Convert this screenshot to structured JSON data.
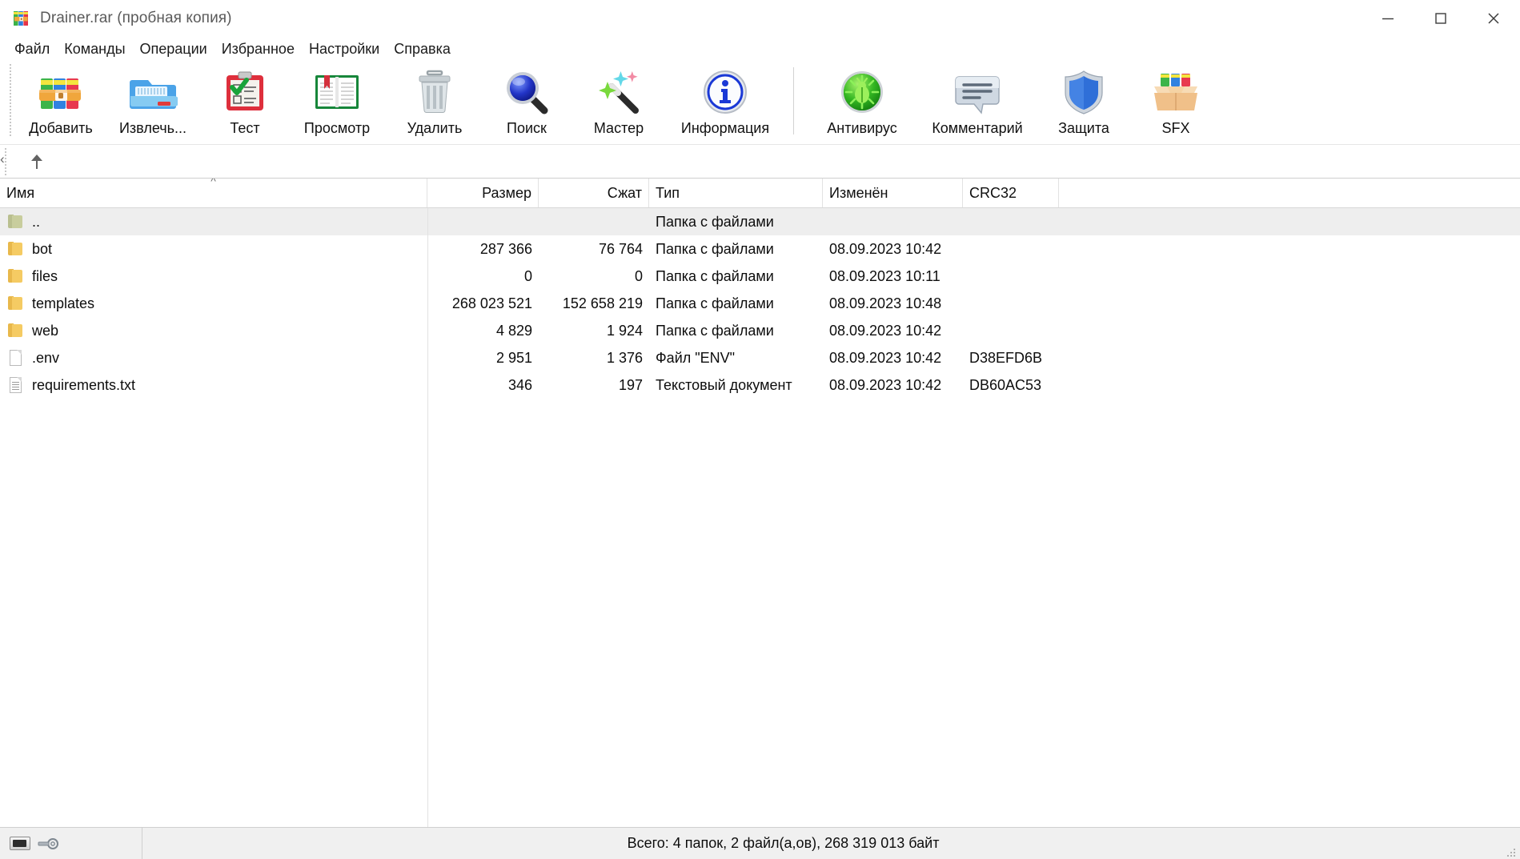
{
  "window": {
    "title": "Drainer.rar (пробная копия)",
    "app_icon": "winrar-books-icon",
    "minimize_label": "—",
    "maximize_label": "□",
    "close_label": "✕"
  },
  "menu": {
    "items": [
      {
        "label": "Файл",
        "name": "menu-file"
      },
      {
        "label": "Команды",
        "name": "menu-commands"
      },
      {
        "label": "Операции",
        "name": "menu-operations"
      },
      {
        "label": "Избранное",
        "name": "menu-favorites"
      },
      {
        "label": "Настройки",
        "name": "menu-settings"
      },
      {
        "label": "Справка",
        "name": "menu-help"
      }
    ]
  },
  "toolbar": {
    "buttons": [
      {
        "label": "Добавить",
        "icon": "add-archive-icon",
        "name": "toolbar-add"
      },
      {
        "label": "Извлечь...",
        "icon": "extract-folder-icon",
        "name": "toolbar-extract"
      },
      {
        "label": "Тест",
        "icon": "test-clipboard-icon",
        "name": "toolbar-test"
      },
      {
        "label": "Просмотр",
        "icon": "view-book-icon",
        "name": "toolbar-view"
      },
      {
        "label": "Удалить",
        "icon": "trash-icon",
        "name": "toolbar-delete"
      },
      {
        "label": "Поиск",
        "icon": "magnifier-icon",
        "name": "toolbar-find"
      },
      {
        "label": "Мастер",
        "icon": "magic-wand-icon",
        "name": "toolbar-wizard"
      },
      {
        "label": "Информация",
        "icon": "info-circle-icon",
        "name": "toolbar-info"
      },
      {
        "label": "Антивирус",
        "icon": "antivirus-bug-icon",
        "name": "toolbar-antivirus"
      },
      {
        "label": "Комментарий",
        "icon": "comment-bubble-icon",
        "name": "toolbar-comment"
      },
      {
        "label": "Защита",
        "icon": "shield-icon",
        "name": "toolbar-protect"
      },
      {
        "label": "SFX",
        "icon": "sfx-box-icon",
        "name": "toolbar-sfx"
      }
    ]
  },
  "addressbar": {
    "up_icon": "arrow-up-icon",
    "path_value": ""
  },
  "filelist": {
    "columns": [
      {
        "label": "Имя",
        "name": "column-name",
        "align": "left",
        "sorted": true
      },
      {
        "label": "Размер",
        "name": "column-size",
        "align": "right",
        "sorted": false
      },
      {
        "label": "Сжат",
        "name": "column-packed",
        "align": "right",
        "sorted": false
      },
      {
        "label": "Тип",
        "name": "column-type",
        "align": "left",
        "sorted": false
      },
      {
        "label": "Изменён",
        "name": "column-modified",
        "align": "left",
        "sorted": false
      },
      {
        "label": "CRC32",
        "name": "column-crc32",
        "align": "left",
        "sorted": false
      }
    ],
    "rows": [
      {
        "name": "..",
        "icon": "folder-up-icon",
        "size": "",
        "packed": "",
        "type": "Папка с файлами",
        "modified": "",
        "crc32": "",
        "selected": true
      },
      {
        "name": "bot",
        "icon": "folder-icon",
        "size": "287 366",
        "packed": "76 764",
        "type": "Папка с файлами",
        "modified": "08.09.2023 10:42",
        "crc32": "",
        "selected": false
      },
      {
        "name": "files",
        "icon": "folder-icon",
        "size": "0",
        "packed": "0",
        "type": "Папка с файлами",
        "modified": "08.09.2023 10:11",
        "crc32": "",
        "selected": false
      },
      {
        "name": "templates",
        "icon": "folder-icon",
        "size": "268 023 521",
        "packed": "152 658 219",
        "type": "Папка с файлами",
        "modified": "08.09.2023 10:48",
        "crc32": "",
        "selected": false
      },
      {
        "name": "web",
        "icon": "folder-icon",
        "size": "4 829",
        "packed": "1 924",
        "type": "Папка с файлами",
        "modified": "08.09.2023 10:42",
        "crc32": "",
        "selected": false
      },
      {
        "name": ".env",
        "icon": "file-blank-icon",
        "size": "2 951",
        "packed": "1 376",
        "type": "Файл \"ENV\"",
        "modified": "08.09.2023 10:42",
        "crc32": "D38EFD6B",
        "selected": false
      },
      {
        "name": "requirements.txt",
        "icon": "file-text-icon",
        "size": "346",
        "packed": "197",
        "type": "Текстовый документ",
        "modified": "08.09.2023 10:42",
        "crc32": "DB60AC53",
        "selected": false
      }
    ]
  },
  "statusbar": {
    "disk_icon": "disk-icon",
    "key_icon": "key-icon",
    "total_text": "Всего: 4 папок, 2 файл(а,ов), 268 319 013 байт"
  },
  "colors": {
    "window_bg": "#ffffff",
    "toolbar_bg": "#ffffff",
    "status_bg": "#f0f0f0",
    "selection_bg": "#eeeeee",
    "title_text": "#5a5a5a",
    "body_text": "#0d0d0d",
    "folder_yellow": "#f5cb63",
    "accent_blue": "#1b5fbf"
  }
}
